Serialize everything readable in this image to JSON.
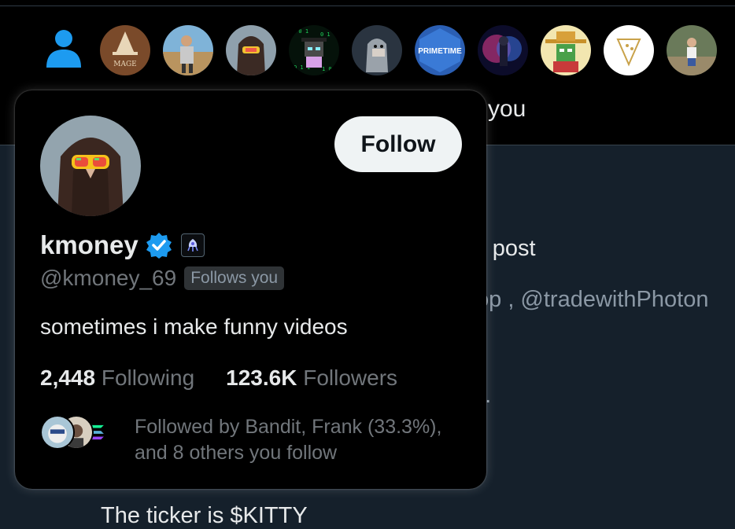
{
  "background": {
    "header_fragment": "you",
    "post_fragment": "ır post",
    "mentions_fragment": "op , @tradewithPhoton",
    "misc_fragment": "g.",
    "bottom_fragment": "The ticker is $KITTY"
  },
  "avatar_strip": {
    "items": [
      {
        "name": "profile-placeholder",
        "label": ""
      },
      {
        "name": "mage-avatar",
        "label": "MAGE"
      },
      {
        "name": "baseball-player-avatar",
        "label": ""
      },
      {
        "name": "hooded-goggles-avatar",
        "label": ""
      },
      {
        "name": "matrix-cat-avatar",
        "label": ""
      },
      {
        "name": "ape-avatar",
        "label": ""
      },
      {
        "name": "primetime-avatar",
        "label": "PRIMETIME"
      },
      {
        "name": "neon-figure-avatar",
        "label": ""
      },
      {
        "name": "sombrero-pepe-avatar",
        "label": ""
      },
      {
        "name": "pizza-logo-avatar",
        "label": ""
      },
      {
        "name": "child-photo-avatar",
        "label": ""
      }
    ]
  },
  "hover_card": {
    "follow_label": "Follow",
    "display_name": "kmoney",
    "handle": "@kmoney_69",
    "follows_you": "Follows you",
    "bio": "sometimes i make funny videos",
    "following_count": "2,448",
    "following_label": "Following",
    "followers_count": "123.6K",
    "followers_label": "Followers",
    "followed_by": "Followed by Bandit, Frank (33.3%), and 8 others you follow"
  },
  "colors": {
    "accent_blue": "#1d9bf0",
    "card_bg": "#000000",
    "page_bg": "#15202b",
    "muted_text": "#71767b"
  }
}
